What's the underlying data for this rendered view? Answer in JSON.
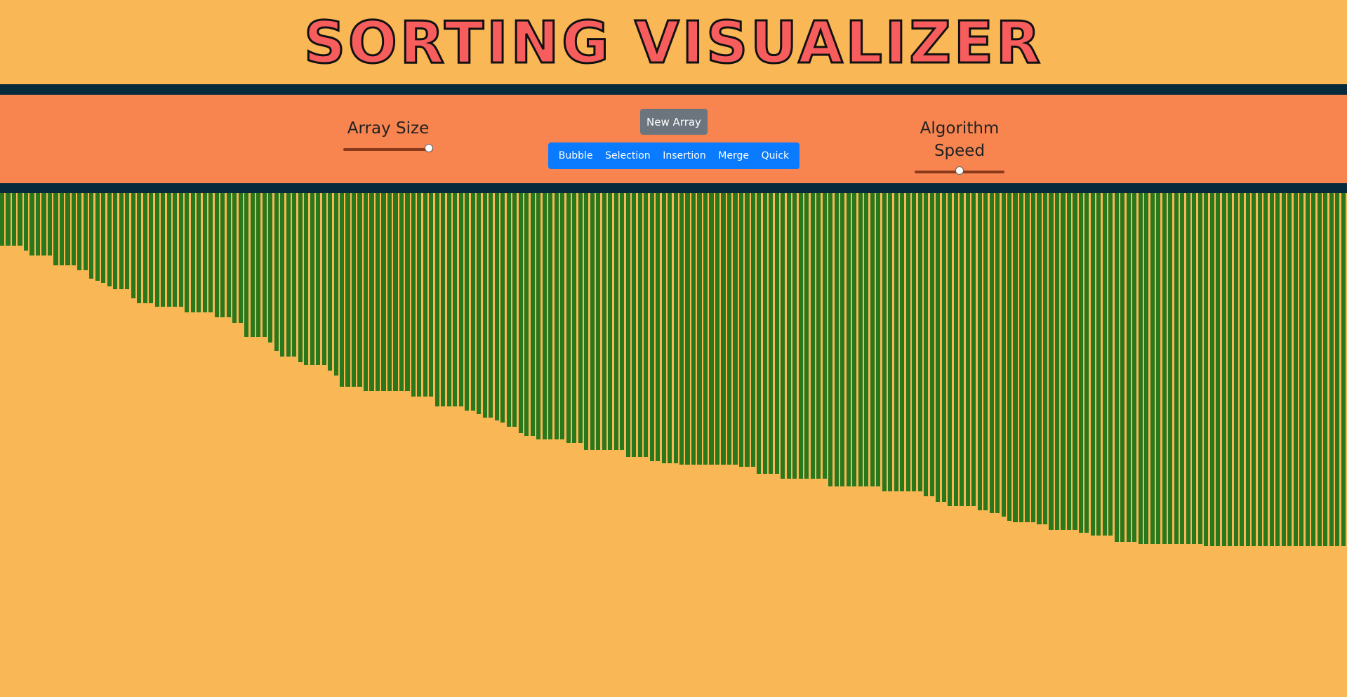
{
  "header": {
    "title": "SORTING VISUALIZER"
  },
  "controls": {
    "array_size": {
      "label": "Array Size",
      "value_fraction": 0.95
    },
    "algorithm_speed": {
      "label": "Algorithm Speed",
      "value_fraction": 0.5
    },
    "new_array_label": "New Array",
    "algorithms": [
      "Bubble",
      "Selection",
      "Insertion",
      "Merge",
      "Quick"
    ]
  },
  "colors": {
    "background": "#f9b755",
    "controls_band": "#f88450",
    "dark_band": "#082a3d",
    "title": "#f85d5d",
    "bar": "#2a781c",
    "algo_buttons": "#0a7bff",
    "new_array_button": "#6c757d"
  },
  "chart_data": {
    "type": "bar",
    "values": [
      75,
      75,
      75,
      75,
      82,
      89,
      89,
      89,
      89,
      103,
      103,
      103,
      103,
      110,
      110,
      122,
      125,
      128,
      133,
      137,
      137,
      137,
      150,
      157,
      157,
      157,
      162,
      162,
      162,
      162,
      162,
      170,
      170,
      170,
      170,
      170,
      177,
      177,
      177,
      185,
      185,
      205,
      205,
      205,
      205,
      213,
      225,
      233,
      233,
      233,
      241,
      245,
      245,
      245,
      245,
      253,
      260,
      276,
      276,
      276,
      276,
      282,
      282,
      282,
      282,
      282,
      282,
      282,
      282,
      290,
      290,
      290,
      290,
      304,
      304,
      304,
      304,
      304,
      310,
      310,
      315,
      320,
      320,
      324,
      327,
      333,
      333,
      342,
      346,
      346,
      351,
      351,
      351,
      351,
      351,
      356,
      356,
      356,
      366,
      366,
      366,
      366,
      366,
      366,
      366,
      376,
      376,
      376,
      376,
      382,
      382,
      385,
      385,
      385,
      387,
      387,
      387,
      387,
      387,
      387,
      387,
      387,
      387,
      387,
      390,
      390,
      390,
      400,
      400,
      400,
      400,
      407,
      407,
      407,
      407,
      407,
      407,
      407,
      407,
      418,
      418,
      418,
      418,
      418,
      418,
      418,
      418,
      418,
      425,
      425,
      425,
      425,
      425,
      425,
      425,
      432,
      432,
      440,
      440,
      446,
      446,
      446,
      446,
      446,
      452,
      452,
      456,
      456,
      461,
      467,
      469,
      469,
      469,
      469,
      472,
      472,
      480,
      480,
      480,
      480,
      480,
      484,
      484,
      488,
      488,
      488,
      488,
      497,
      497,
      497,
      497,
      500,
      500,
      500,
      500,
      500,
      500,
      500,
      500,
      500,
      500,
      500,
      503,
      503,
      503,
      503,
      503,
      503,
      503,
      503,
      503,
      503,
      503,
      503,
      503,
      503,
      503,
      503,
      503,
      503,
      503,
      503,
      503,
      503,
      503,
      503
    ]
  }
}
